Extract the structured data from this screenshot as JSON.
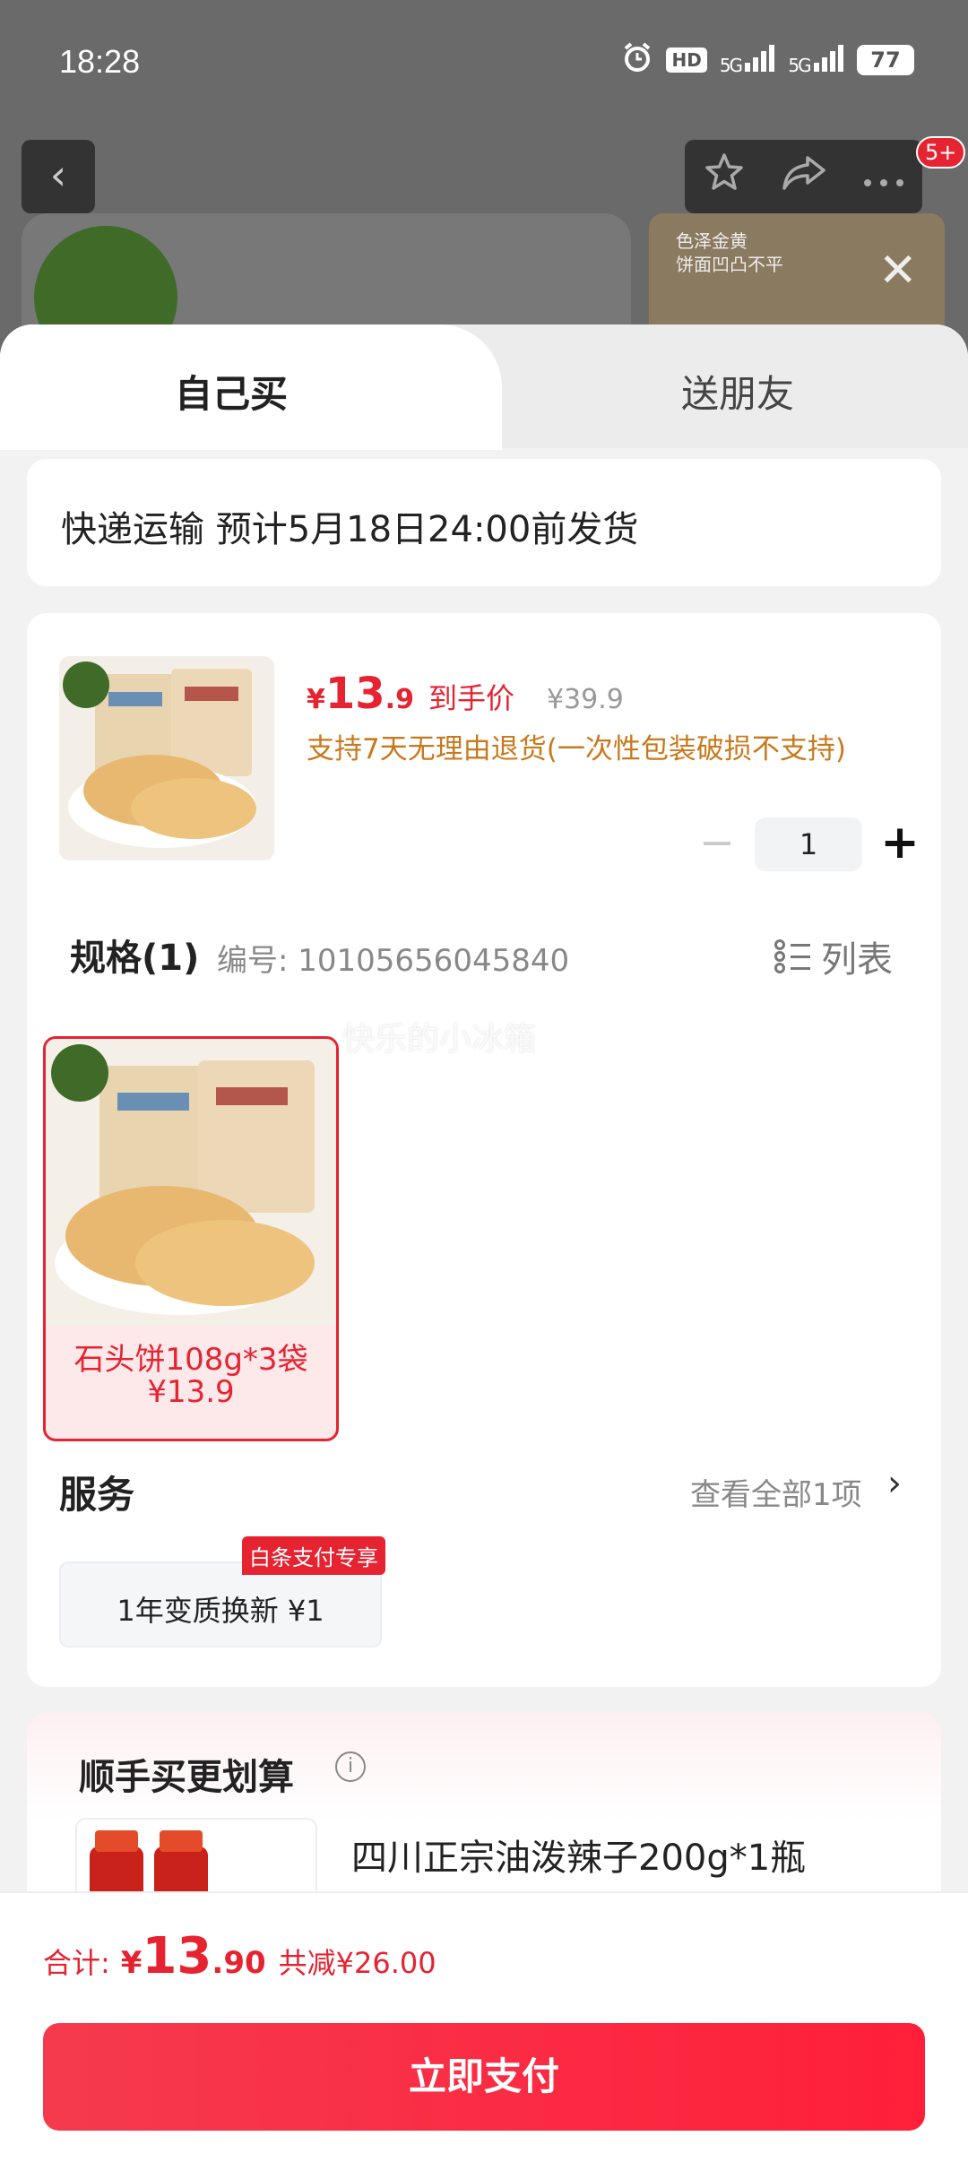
{
  "status_bar": {
    "time": "18:28",
    "hd": "HD",
    "net1": "5G",
    "net2": "5G",
    "battery": "77"
  },
  "background_page": {
    "badge": "5+",
    "promo_text_line1": "色泽金黄",
    "promo_text_line2": "饼面凹凸不平"
  },
  "tabs": {
    "self_buy": "自己买",
    "gift": "送朋友"
  },
  "shipping": {
    "text": "快递运输 预计5月18日24:00前发货"
  },
  "product": {
    "price_yen": "¥",
    "price_int": "13",
    "price_dec": ".9",
    "price_label": "到手价",
    "original_price": "¥39.9",
    "return_policy": "支持7天无理由退货(一次性包装破损不支持)",
    "quantity": "1"
  },
  "spec": {
    "title": "规格(1)",
    "code": "编号: 10105656045840",
    "list_toggle": "列表",
    "options": [
      {
        "name": "石头饼108g*3袋",
        "price": "¥13.9",
        "selected": true
      }
    ]
  },
  "watermark": "快乐的小冰箱",
  "service": {
    "title": "服务",
    "view_all": "查看全部1项",
    "item": "1年变质换新 ¥1",
    "badge": "白条支付专享"
  },
  "addon": {
    "title": "顺手买更划算",
    "item_name": "四川正宗油泼辣子200g*1瓶"
  },
  "checkout": {
    "total_label": "合计:",
    "total_yen": "¥",
    "total_int": "13",
    "total_dec": ".90",
    "discount": "共减¥26.00",
    "pay_button": "立即支付"
  },
  "colors": {
    "accent": "#e52331",
    "return_text": "#c8791c"
  }
}
